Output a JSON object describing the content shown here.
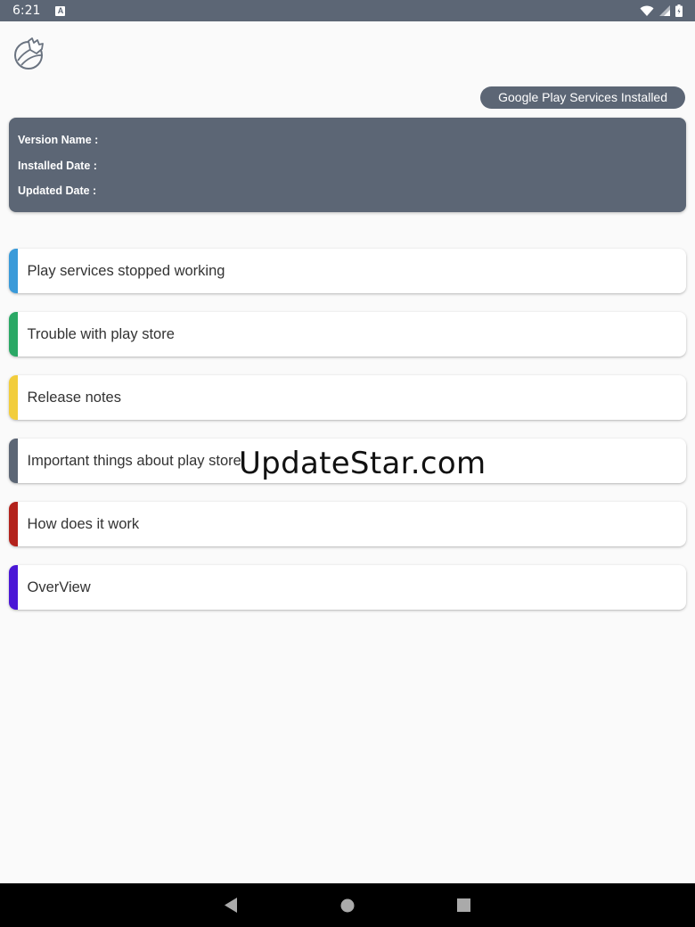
{
  "status_bar": {
    "time": "6:21",
    "notification_icon": "a-letter-icon",
    "icons": [
      "wifi-icon",
      "signal-icon",
      "battery-icon"
    ]
  },
  "app": {
    "logo_icon": "hand-ball-logo-icon",
    "installed_badge": "Google Play Services Installed"
  },
  "info_card": {
    "version_name_label": "Version Name :",
    "installed_date_label": "Installed Date :",
    "updated_date_label": "Updated Date :"
  },
  "menu": {
    "items": [
      {
        "label": "Play services stopped working",
        "accent": "#3a9ad9"
      },
      {
        "label": "Trouble with play store",
        "accent": "#2aa865"
      },
      {
        "label": "Release notes",
        "accent": "#f2cd3c"
      },
      {
        "label": "Important things about play store",
        "accent": "#5c6675"
      },
      {
        "label": "How does it work",
        "accent": "#b3221c"
      },
      {
        "label": "OverView",
        "accent": "#4a17d6"
      }
    ]
  },
  "watermark": "UpdateStar.com",
  "nav_bar": {
    "icons": [
      "back-icon",
      "home-icon",
      "recents-icon"
    ]
  },
  "colors": {
    "primary": "#5c6675",
    "background": "#fafafa"
  }
}
